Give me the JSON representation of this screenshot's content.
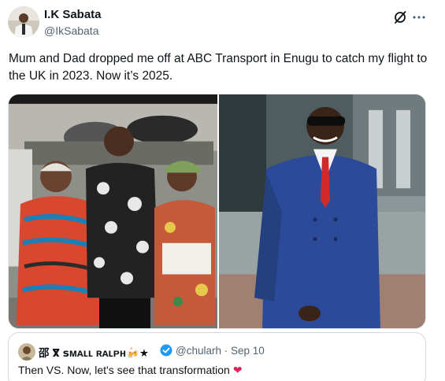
{
  "author": {
    "display_name": "I.K Sabata",
    "handle": "@IkSabata"
  },
  "tweet": {
    "text": "Mum and Dad dropped me off at ABC Transport in Enugu to catch my flight to the UK in 2023. Now it’s 2025."
  },
  "icons": {
    "grok": "grok-slash-icon",
    "more": "more-dots-icon",
    "verified": "verified-badge-icon",
    "heart": "heart-icon"
  },
  "quote": {
    "display_name": "邵 ⴳ ꜱᴍᴀʟʟ ʀᴀʟᴘʜ🍻★",
    "handle_time": "@chularh · Sep 10",
    "text": "Then VS. Now, let's see that transformation",
    "heart": "❤"
  },
  "colors": {
    "verified": "#1d9bf0",
    "heart": "#e0245e",
    "secondary_text": "#536471"
  }
}
